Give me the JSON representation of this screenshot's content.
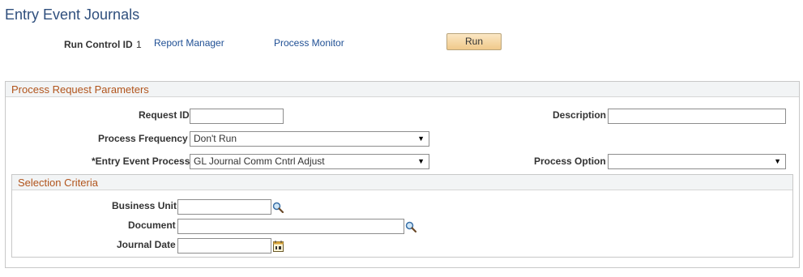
{
  "page": {
    "title": "Entry Event Journals"
  },
  "header": {
    "run_control_label": "Run Control ID",
    "run_control_value": "1",
    "report_manager_link": "Report Manager",
    "process_monitor_link": "Process Monitor",
    "run_button": "Run"
  },
  "process_request": {
    "title": "Process Request Parameters",
    "request_id": {
      "label": "Request ID",
      "value": ""
    },
    "description": {
      "label": "Description",
      "value": ""
    },
    "process_frequency": {
      "label": "Process Frequency",
      "value": "Don't Run"
    },
    "entry_event_process": {
      "label": "*Entry Event Process",
      "value": "GL Journal Comm Cntrl Adjust"
    },
    "process_option": {
      "label": "Process Option",
      "value": ""
    }
  },
  "selection_criteria": {
    "title": "Selection Criteria",
    "business_unit": {
      "label": "Business Unit",
      "value": ""
    },
    "document": {
      "label": "Document",
      "value": ""
    },
    "journal_date": {
      "label": "Journal Date",
      "value": ""
    }
  },
  "icons": {
    "lookup": "magnifier-icon",
    "calendar": "calendar-icon",
    "dropdown": "chevron-down-icon"
  },
  "colors": {
    "title": "#2f4f7d",
    "link": "#1f4f94",
    "group_title": "#b1541c",
    "button": "#f0c98a"
  }
}
